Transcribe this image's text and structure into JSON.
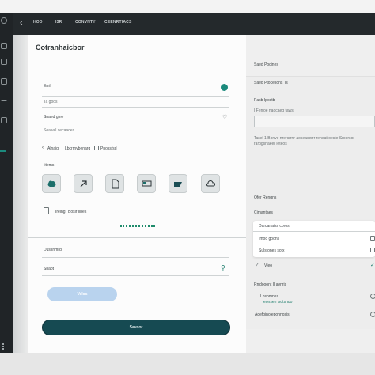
{
  "topbar": {
    "crumbs": [
      "HOD",
      "I3R",
      "CONVNTY",
      "CEENRTIACS"
    ]
  },
  "page": {
    "title": "Cotranhaicbor"
  },
  "form": {
    "field1_label": "Emlt",
    "field1_value": "Ta goos",
    "field2_label": "Snaed gine",
    "field2_value": "Soalvel secaaoes",
    "option1_label": "Alnaig",
    "option2_label": "Lbcrrnybenarg",
    "option3_label": "Pnossfsd",
    "section_label": "Iitems",
    "file_label": "Ireing",
    "file_name": "Bosir Ilbes",
    "section2_label": "Dussnmrd",
    "search_label": "Snaot",
    "button_light": "Velos",
    "button_dark": "Savcor"
  },
  "right": {
    "header": "Saed Pocines",
    "sub1": "Saed Ptocesons Ts",
    "label1": "Pasb Ipostb",
    "field_hint": "I Ferroe naocaeg taws",
    "help": "Tasel 1 Bonve nrercrrnr aoseacerrr reneat oeste Sroersor rarpgsnaeer leteos",
    "sec2": "Ofer Rengns",
    "sec2_sub": "Cimantaes",
    "card_row1": "Darcanaiss  coros",
    "card_row2": "Imod goons",
    "card_row3": "Sulstones sotx",
    "check_label": "Vleo",
    "sec3": "Rrrdooont II avnris",
    "list1": "Losomnes",
    "list1_sub": "eonsen lsotsnuo",
    "list2": "Agefbinoieponnosis"
  }
}
